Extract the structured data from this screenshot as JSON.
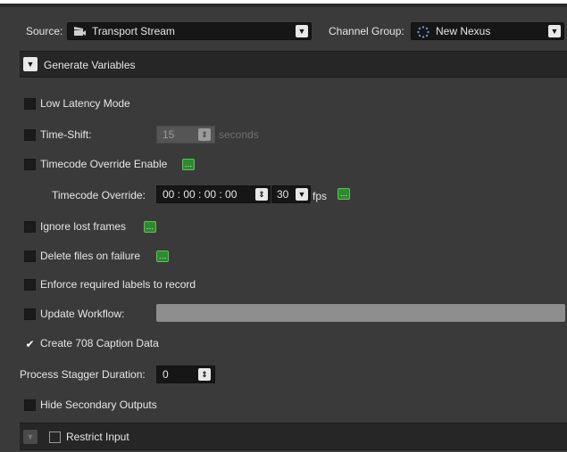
{
  "source": {
    "label": "Source:",
    "value": "Transport Stream",
    "icon": "clapperboard-icon"
  },
  "channel_group": {
    "label": "Channel Group:",
    "value": "New Nexus",
    "icon": "spinner-icon"
  },
  "generate_variables": {
    "label": "Generate Variables",
    "expanded": true
  },
  "options": {
    "low_latency": {
      "label": "Low Latency Mode",
      "checked": false
    },
    "time_shift": {
      "label": "Time-Shift:",
      "checked": false,
      "value": "15",
      "unit": "seconds"
    },
    "timecode_override_enable": {
      "label": "Timecode Override Enable",
      "checked": false
    },
    "timecode_override": {
      "label": "Timecode Override:",
      "value": "00 : 00 : 00 : 00",
      "fps_value": "30",
      "fps_label": "fps"
    },
    "ignore_lost_frames": {
      "label": "Ignore lost frames",
      "checked": false
    },
    "delete_on_failure": {
      "label": "Delete files on failure",
      "checked": false
    },
    "enforce_labels": {
      "label": "Enforce required labels to record",
      "checked": false
    },
    "update_workflow": {
      "label": "Update Workflow:",
      "checked": false,
      "value": ""
    },
    "create_708": {
      "label": "Create 708 Caption Data",
      "checked": true,
      "check_glyph": "✔"
    },
    "process_stagger": {
      "label": "Process Stagger Duration:",
      "value": "0"
    },
    "hide_secondary": {
      "label": "Hide Secondary Outputs",
      "checked": false
    }
  },
  "restrict_input": {
    "label": "Restrict Input",
    "checked": false,
    "expanded": false
  },
  "glyphs": {
    "dropdown": "▼",
    "spin": "⇕",
    "green_button": "…",
    "expand_open": "▼"
  },
  "colors": {
    "accent_green": "#2e8a2e",
    "background": "#3a3a3a",
    "panel": "#262626"
  }
}
